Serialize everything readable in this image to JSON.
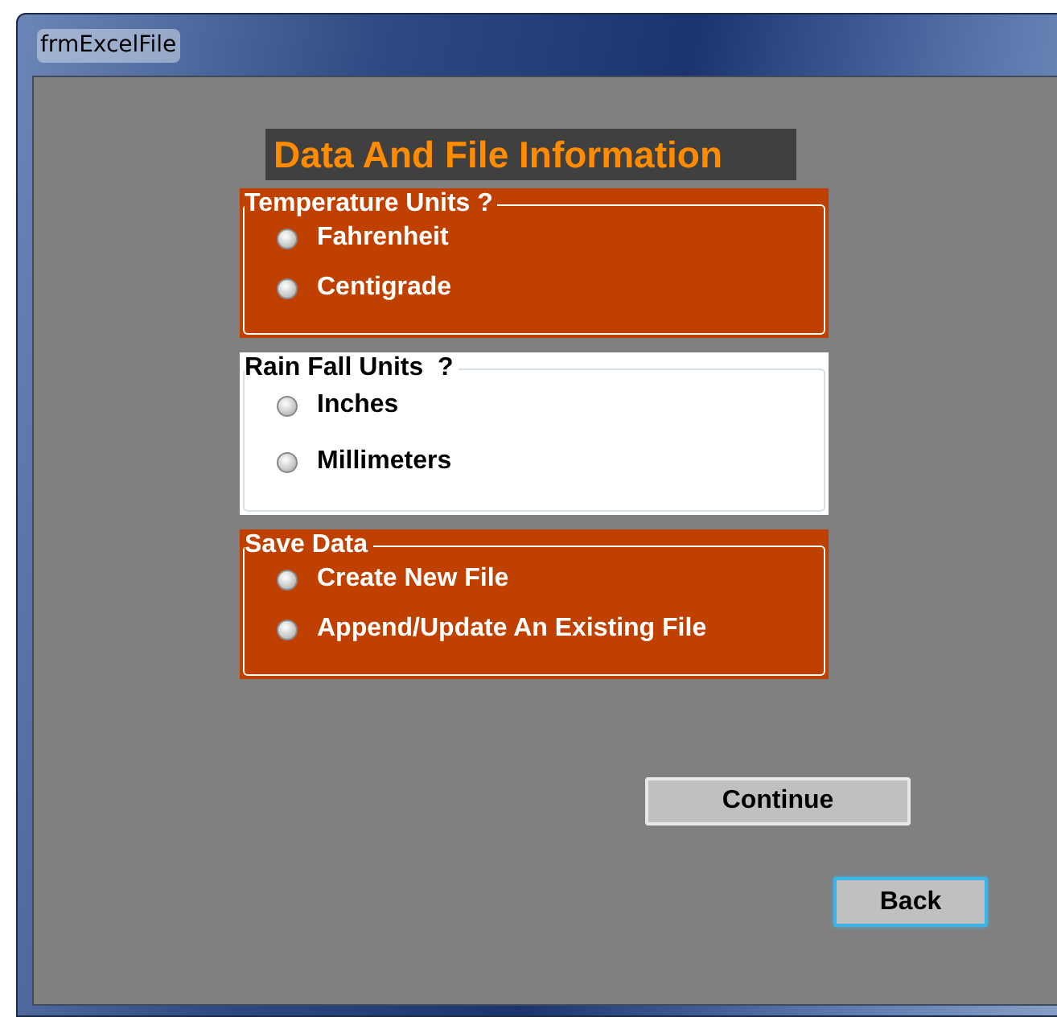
{
  "window": {
    "title": "frmExcelFile"
  },
  "heading": "Data And File Information",
  "groups": [
    {
      "title": "Temperature Units ?",
      "color": "#c04000",
      "options": [
        {
          "label": "Fahrenheit",
          "selected": false
        },
        {
          "label": "Centigrade",
          "selected": false
        }
      ]
    },
    {
      "title": "Rain Fall Units  ?",
      "color": "#ffffff",
      "options": [
        {
          "label": "Inches",
          "selected": false
        },
        {
          "label": "Millimeters",
          "selected": false
        }
      ]
    },
    {
      "title": "Save Data",
      "color": "#c04000",
      "options": [
        {
          "label": "Create New File",
          "selected": false
        },
        {
          "label": "Append/Update An Existing File",
          "selected": false
        }
      ]
    }
  ],
  "buttons": [
    {
      "label": "Continue",
      "focused": false
    },
    {
      "label": "Back",
      "focused": true
    }
  ]
}
